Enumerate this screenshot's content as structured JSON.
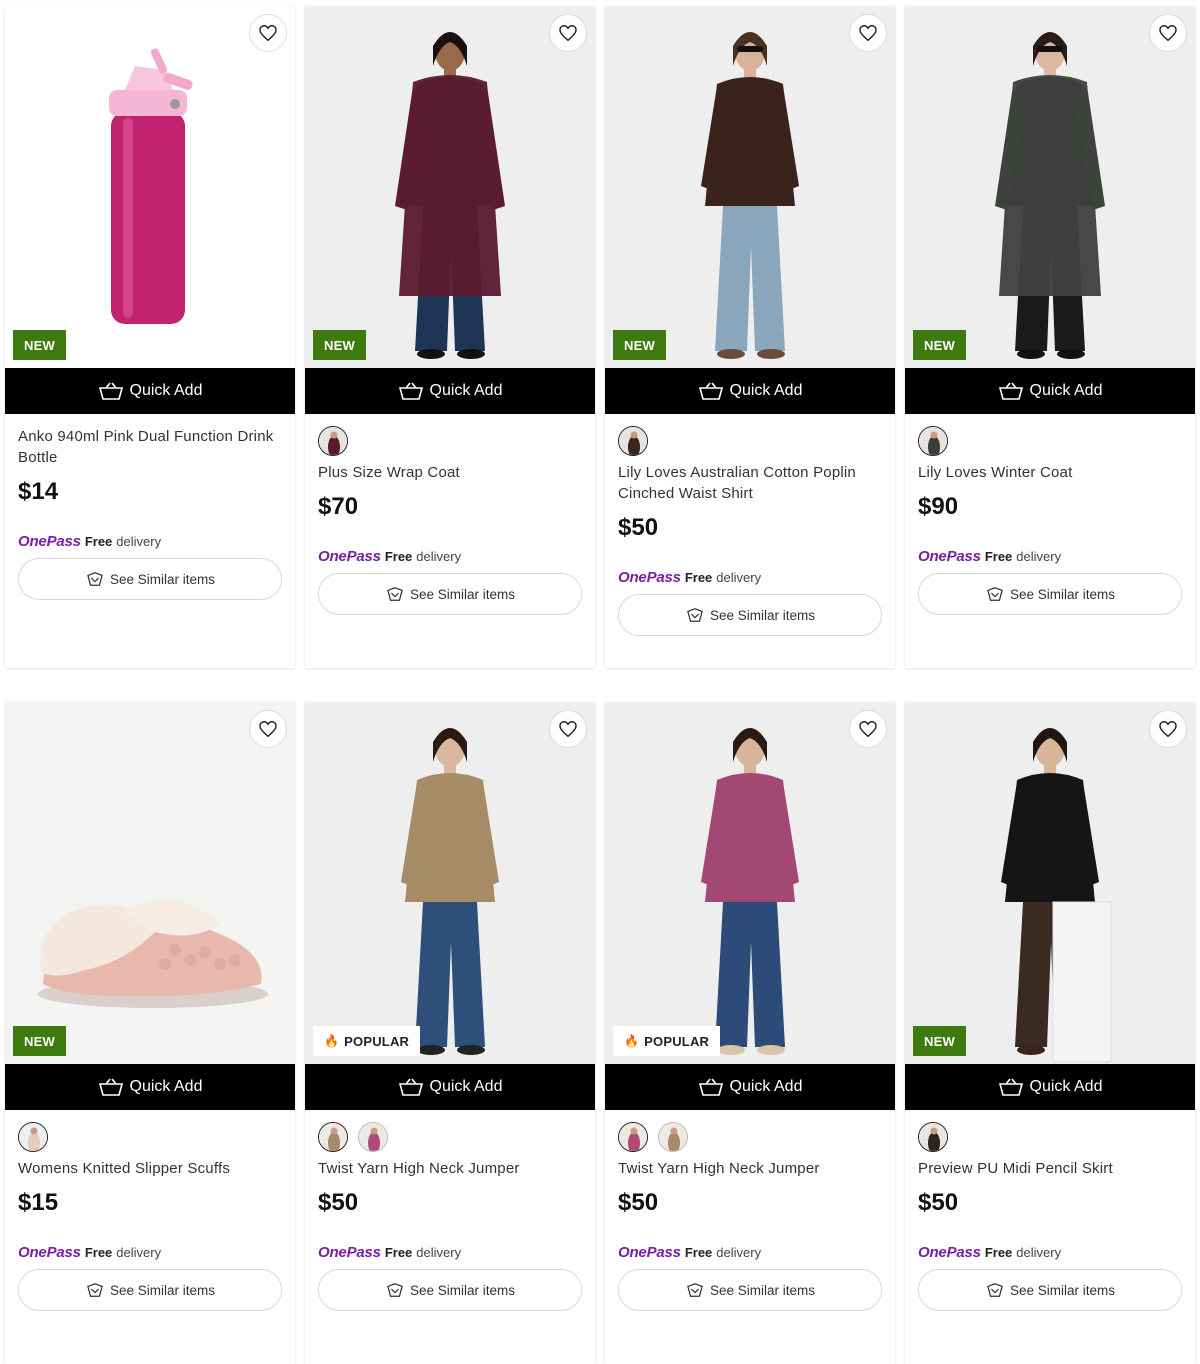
{
  "colors": {
    "new_badge": "#3e7b0f",
    "onepass": "#7a1fa2",
    "quick_add_bg": "#000000"
  },
  "common": {
    "quick_add": "Quick Add",
    "see_similar": "See Similar items",
    "onepass": "OnePass",
    "free": "Free",
    "delivery": "delivery",
    "wishlist_icon": "heart-icon",
    "basket_icon": "basket-icon"
  },
  "products": [
    {
      "name": "Anko 940ml Pink Dual Function Drink Bottle",
      "price": "$14",
      "badge": "NEW",
      "swatches": []
    },
    {
      "name": "Plus Size Wrap Coat",
      "price": "$70",
      "badge": "NEW",
      "swatches": [
        "burgundy"
      ]
    },
    {
      "name": "Lily Loves Australian Cotton Poplin Cinched Waist Shirt",
      "price": "$50",
      "badge": "NEW",
      "swatches": [
        "brown"
      ]
    },
    {
      "name": "Lily Loves Winter Coat",
      "price": "$90",
      "badge": "NEW",
      "swatches": [
        "charcoal"
      ]
    },
    {
      "name": "Womens Knitted Slipper Scuffs",
      "price": "$15",
      "badge": "NEW",
      "swatches": [
        "pink"
      ]
    },
    {
      "name": "Twist Yarn High Neck Jumper",
      "price": "$50",
      "badge": "POPULAR",
      "swatches": [
        "oatmeal",
        "berry"
      ]
    },
    {
      "name": "Twist Yarn High Neck Jumper",
      "price": "$50",
      "badge": "POPULAR",
      "swatches": [
        "berry",
        "oatmeal"
      ]
    },
    {
      "name": "Preview PU Midi Pencil Skirt",
      "price": "$50",
      "badge": "NEW",
      "swatches": [
        "chocolate"
      ]
    }
  ]
}
